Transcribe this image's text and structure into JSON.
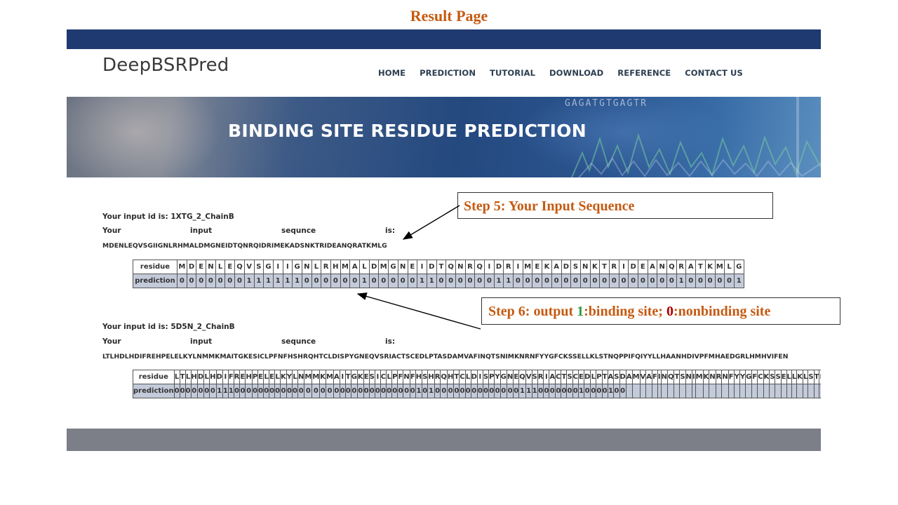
{
  "page_title": "Result Page",
  "brand": "DeepBSRPred",
  "nav": [
    "HOME",
    "PREDICTION",
    "TUTORIAL",
    "DOWNLOAD",
    "REFERENCE",
    "CONTACT US"
  ],
  "hero": {
    "title": "BINDING SITE RESIDUE PREDICTION",
    "bg_sequence": "GAGATGTGAGTR"
  },
  "results": [
    {
      "id_label": "Your input id is: 1XTG_2_ChainB",
      "seq_label_words": [
        "Your",
        "input",
        "sequnce",
        "is:"
      ],
      "sequence": "MDENLEQVSGIIGNLRHMALDMGNEIDTQNRQIDRIMEKADSNKTRIDEANQRATKMLG",
      "row_labels": {
        "residue": "residue",
        "prediction": "prediction"
      },
      "predictions": "00000001111110000001000001100000011000000000000000001000001 0"
    },
    {
      "id_label": "Your input id is: 5D5N_2_ChainB",
      "seq_label_words": [
        "Your",
        "input",
        "sequnce",
        "is:"
      ],
      "sequence": "LTLHDLHDIFREHPELELKYLNMMKMAITGKESICLPFNFHSHRQHTCLDISPYGNEQVSRIACTSCEDLPTASDAMVAFINQTSNIMKNRNFYYGFCKSSELLKLSTNQPPIFQIYYLLHAANHDIVPFMHAEDGRLHMHVIFEN",
      "row_labels": {
        "residue": "residue",
        "prediction": "prediction"
      },
      "predictions": "000000011100000000000000000000000000000010100000000000000111000000010000100"
    }
  ],
  "callouts": {
    "step5": "Step 5: Your Input Sequence",
    "step6_prefix": "Step 6: output ",
    "step6_one": "1",
    "step6_mid": ":binding site; ",
    "step6_zero": "0",
    "step6_suffix": ":nonbinding site"
  },
  "colors": {
    "title_orange": "#c55a11",
    "topbar_navy": "#1f3a70",
    "binding_green": "#2e9b3e",
    "nonbinding_red": "#b00000",
    "prediction_row": "#c3cad9",
    "footer_gray": "#7c7f88"
  }
}
